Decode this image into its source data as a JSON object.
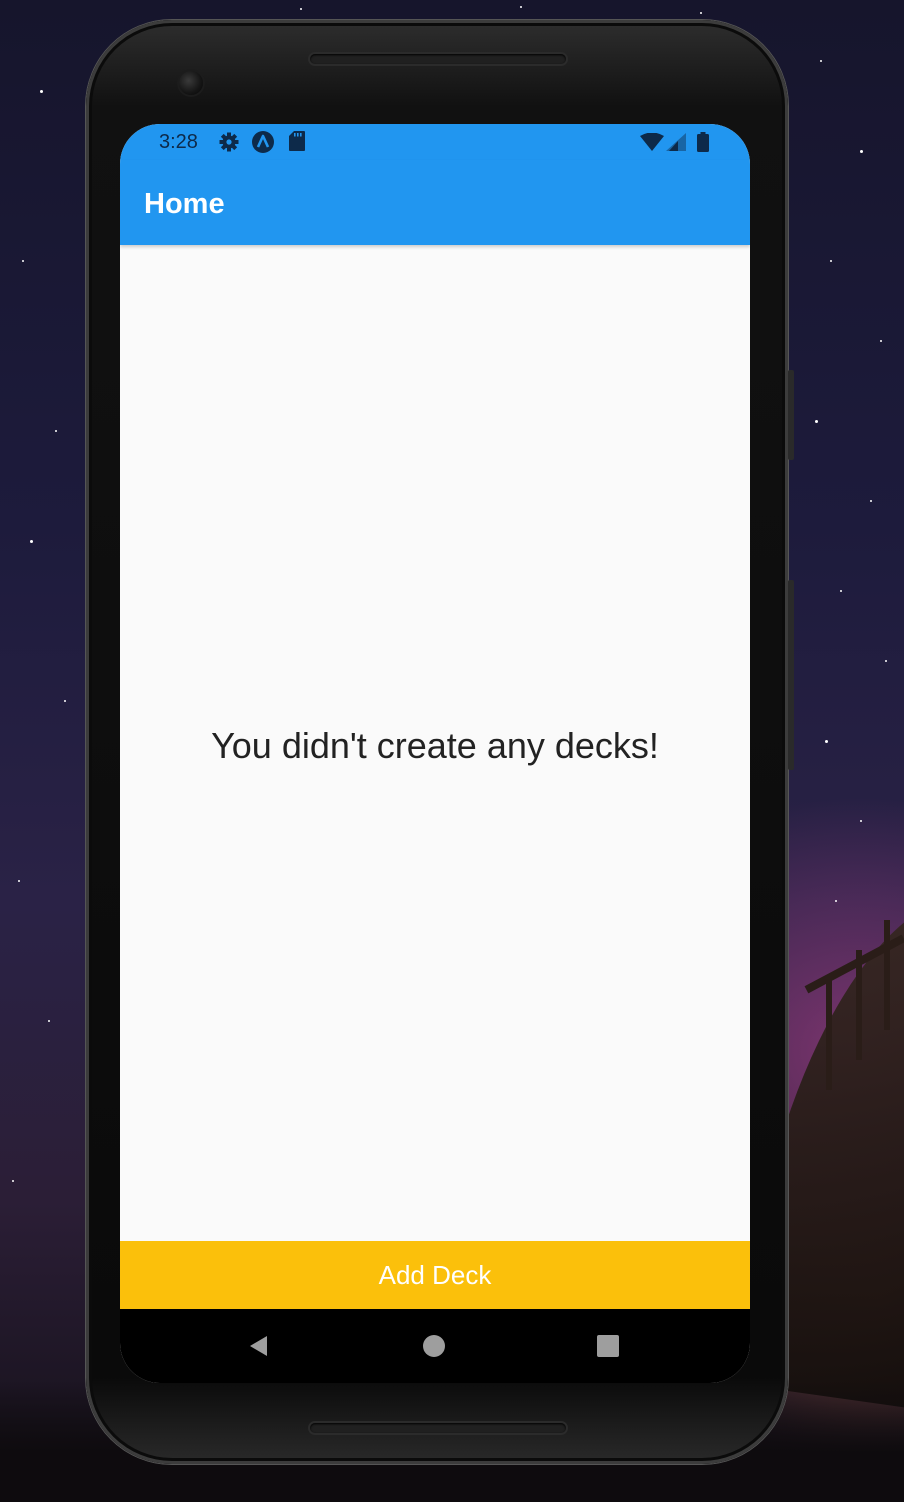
{
  "status_bar": {
    "time": "3:28",
    "left_icons": [
      "gear-icon",
      "app-a-icon",
      "sd-card-icon"
    ],
    "right_icons": [
      "wifi-icon",
      "cell-signal-icon",
      "battery-icon"
    ]
  },
  "app_bar": {
    "title": "Home"
  },
  "main": {
    "empty_message": "You didn't create any decks!"
  },
  "footer": {
    "add_deck_label": "Add Deck"
  },
  "navigation": {
    "buttons": [
      "back-icon",
      "home-icon",
      "recents-icon"
    ]
  },
  "colors": {
    "app_bar": "#2196f0",
    "add_button": "#fbc00b",
    "background": "#fafafa",
    "status_icons": "#0d2a4a"
  }
}
